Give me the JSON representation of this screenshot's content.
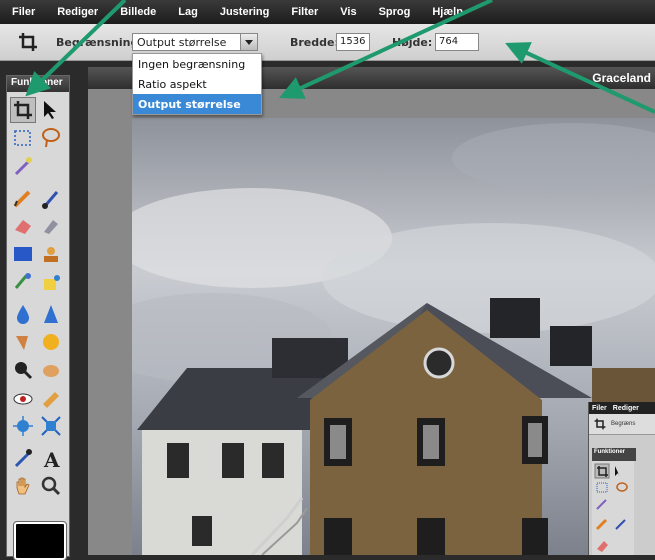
{
  "menu": {
    "items": [
      "Filer",
      "Rediger",
      "Billede",
      "Lag",
      "Justering",
      "Filter",
      "Vis",
      "Sprog",
      "Hjælp"
    ]
  },
  "options": {
    "constraint_label": "Begrænsning:",
    "constraint_value": "Output størrelse",
    "width_label": "Bredde:",
    "width_value": "1536",
    "height_label": "Højde:",
    "height_value": "764"
  },
  "dropdown": {
    "options": [
      "Ingen begrænsning",
      "Ratio aspekt",
      "Output størrelse"
    ],
    "selected": "Output størrelse"
  },
  "tools": {
    "title": "Funktioner"
  },
  "canvas": {
    "title": "Graceland"
  },
  "nested": {
    "menu": [
      "Filer",
      "Rediger"
    ],
    "constraint_label": "Begræns",
    "tools_title": "Funktioner"
  },
  "colors": {
    "accent": "#3a89d6",
    "arrow": "#1f9a6e",
    "foreground_swatch": "#000000"
  }
}
